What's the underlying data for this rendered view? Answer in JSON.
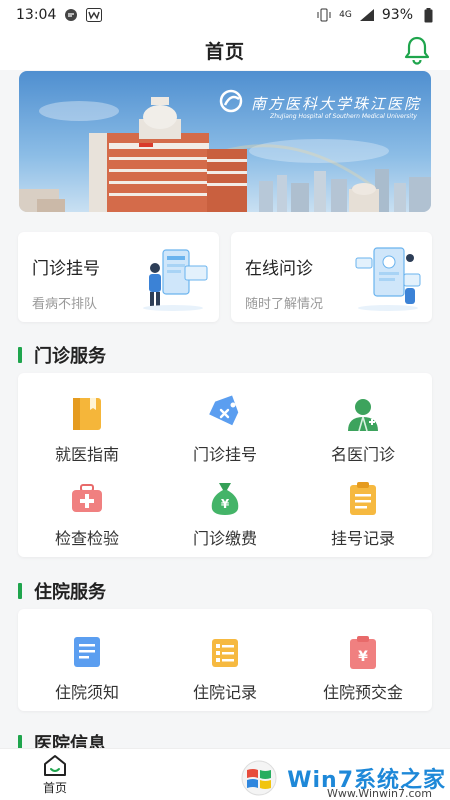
{
  "status_bar": {
    "time": "13:04",
    "battery": "93%",
    "network": "4G"
  },
  "header": {
    "title": "首页"
  },
  "banner": {
    "logo_text": "南方医科大学珠江医院",
    "logo_sub": "ZhuJiang Hospital of Southern Medical University"
  },
  "quick_actions": [
    {
      "title": "门诊挂号",
      "subtitle": "看病不排队"
    },
    {
      "title": "在线问诊",
      "subtitle": "随时了解情况"
    }
  ],
  "sections": {
    "outpatient": {
      "title": "门诊服务",
      "items": [
        {
          "label": "就医指南",
          "icon": "guide-book-icon"
        },
        {
          "label": "门诊挂号",
          "icon": "ticket-tag-icon"
        },
        {
          "label": "名医门诊",
          "icon": "doctor-icon"
        },
        {
          "label": "检查检验",
          "icon": "medical-kit-icon"
        },
        {
          "label": "门诊缴费",
          "icon": "money-bag-icon"
        },
        {
          "label": "挂号记录",
          "icon": "clipboard-list-icon"
        }
      ]
    },
    "inpatient": {
      "title": "住院服务",
      "items": [
        {
          "label": "住院须知",
          "icon": "document-icon"
        },
        {
          "label": "住院记录",
          "icon": "record-icon"
        },
        {
          "label": "住院预交金",
          "icon": "deposit-clipboard-icon"
        }
      ]
    },
    "info": {
      "title": "医院信息"
    }
  },
  "tab_bar": {
    "tabs": [
      {
        "label": "首页",
        "icon": "home-icon"
      }
    ]
  },
  "watermark": {
    "brand": "Win7系统之家",
    "url": "Www.Winwin7.com"
  },
  "colors": {
    "accent": "#1fa54d",
    "background": "#f5f6f7"
  }
}
